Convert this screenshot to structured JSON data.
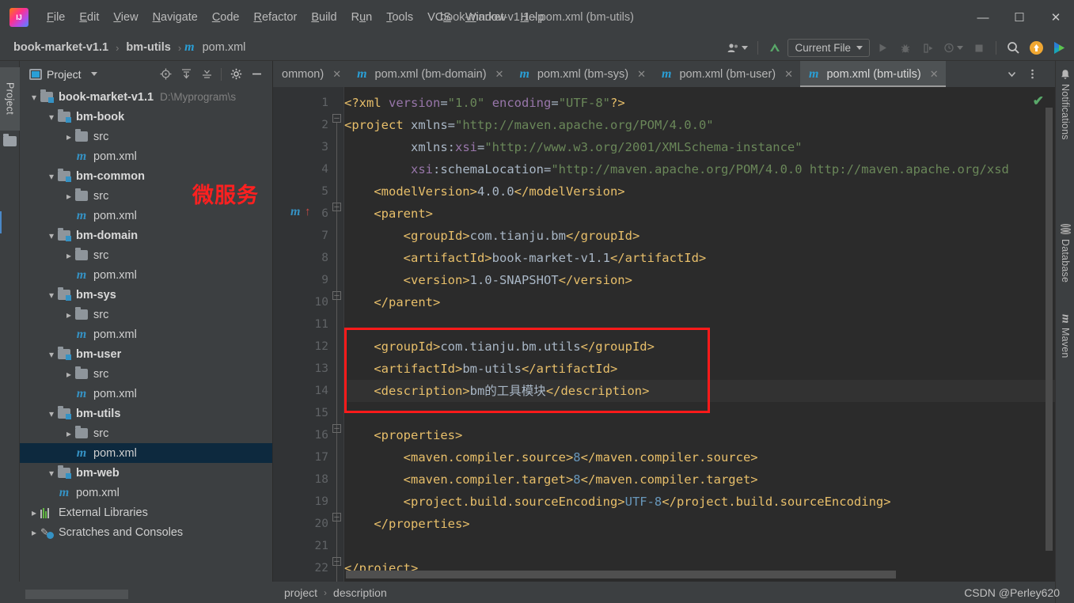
{
  "window": {
    "title": "book-market-v1.1 - pom.xml (bm-utils)",
    "minimize_label": "—",
    "maximize_label": "☐",
    "close_label": "✕",
    "logo_name": "intellij-idea-logo"
  },
  "menu": [
    {
      "label": "File",
      "mnemonic": "F"
    },
    {
      "label": "Edit",
      "mnemonic": "E"
    },
    {
      "label": "View",
      "mnemonic": "V"
    },
    {
      "label": "Navigate",
      "mnemonic": "N"
    },
    {
      "label": "Code",
      "mnemonic": "C"
    },
    {
      "label": "Refactor",
      "mnemonic": "R"
    },
    {
      "label": "Build",
      "mnemonic": "B"
    },
    {
      "label": "Run",
      "mnemonic": "u"
    },
    {
      "label": "Tools",
      "mnemonic": "T"
    },
    {
      "label": "VCS",
      "mnemonic": "S"
    },
    {
      "label": "Window",
      "mnemonic": "W"
    },
    {
      "label": "Help",
      "mnemonic": "H"
    }
  ],
  "breadcrumb": {
    "items": [
      "book-market-v1.1",
      "bm-utils",
      "pom.xml"
    ],
    "separator": "›",
    "file_icon": "m"
  },
  "toolbar": {
    "avatar_icon": "user-avatar-icon",
    "update_icon": "update-project-icon",
    "run_config": "Current File",
    "run_icon": "run-icon",
    "debug_icon": "debug-icon",
    "run_coverage_icon": "run-with-coverage-icon",
    "profile_icon": "profiler-icon",
    "stop_icon": "stop-icon",
    "search_icon": "search-everywhere-icon",
    "upload_icon": "upload-icon",
    "ide_assistant_icon": "ide-extension-icon"
  },
  "left_strip": {
    "project_label": "Project",
    "folder_icon": "folder-icon"
  },
  "project_panel": {
    "title": "Project",
    "actions": [
      "locate-icon",
      "expand-all-icon",
      "collapse-all-icon",
      "settings-gear-icon",
      "hide-icon"
    ],
    "annotation": "微服务",
    "tree": [
      {
        "label": "book-market-v1.1",
        "path": "D:\\Myprogram\\s",
        "icon": "module-folder-icon",
        "twisty": "open",
        "indent": 1,
        "bold": true
      },
      {
        "label": "bm-book",
        "icon": "module-folder-icon",
        "twisty": "open",
        "indent": 2,
        "bold": true
      },
      {
        "label": "src",
        "icon": "folder-icon",
        "twisty": "closed",
        "indent": 3,
        "bold": false
      },
      {
        "label": "pom.xml",
        "icon": "maven-file-icon",
        "twisty": "none",
        "indent": 3,
        "bold": false
      },
      {
        "label": "bm-common",
        "icon": "module-folder-icon",
        "twisty": "open",
        "indent": 2,
        "bold": true
      },
      {
        "label": "src",
        "icon": "folder-icon",
        "twisty": "closed",
        "indent": 3,
        "bold": false
      },
      {
        "label": "pom.xml",
        "icon": "maven-file-icon",
        "twisty": "none",
        "indent": 3,
        "bold": false
      },
      {
        "label": "bm-domain",
        "icon": "module-folder-icon",
        "twisty": "open",
        "indent": 2,
        "bold": true
      },
      {
        "label": "src",
        "icon": "folder-icon",
        "twisty": "closed",
        "indent": 3,
        "bold": false
      },
      {
        "label": "pom.xml",
        "icon": "maven-file-icon",
        "twisty": "none",
        "indent": 3,
        "bold": false
      },
      {
        "label": "bm-sys",
        "icon": "module-folder-icon",
        "twisty": "open",
        "indent": 2,
        "bold": true
      },
      {
        "label": "src",
        "icon": "folder-icon",
        "twisty": "closed",
        "indent": 3,
        "bold": false
      },
      {
        "label": "pom.xml",
        "icon": "maven-file-icon",
        "twisty": "none",
        "indent": 3,
        "bold": false
      },
      {
        "label": "bm-user",
        "icon": "module-folder-icon",
        "twisty": "open",
        "indent": 2,
        "bold": true
      },
      {
        "label": "src",
        "icon": "folder-icon",
        "twisty": "closed",
        "indent": 3,
        "bold": false
      },
      {
        "label": "pom.xml",
        "icon": "maven-file-icon",
        "twisty": "none",
        "indent": 3,
        "bold": false
      },
      {
        "label": "bm-utils",
        "icon": "module-folder-icon",
        "twisty": "open",
        "indent": 2,
        "bold": true
      },
      {
        "label": "src",
        "icon": "folder-icon",
        "twisty": "closed",
        "indent": 3,
        "bold": false
      },
      {
        "label": "pom.xml",
        "icon": "maven-file-icon",
        "twisty": "none",
        "indent": 3,
        "bold": false,
        "selected": true
      },
      {
        "label": "bm-web",
        "icon": "module-folder-icon",
        "twisty": "open",
        "indent": 2,
        "bold": true
      },
      {
        "label": "pom.xml",
        "icon": "maven-file-icon",
        "twisty": "none",
        "indent": 2,
        "bold": false
      },
      {
        "label": "External Libraries",
        "icon": "libraries-icon",
        "twisty": "closed",
        "indent": 1,
        "bold": false
      },
      {
        "label": "Scratches and Consoles",
        "icon": "scratches-icon",
        "twisty": "closed",
        "indent": 1,
        "bold": false
      }
    ]
  },
  "editor_tabs": {
    "tabs": [
      {
        "label": "ommon)",
        "icon": "",
        "active": false,
        "clipped": true
      },
      {
        "label": "pom.xml (bm-domain)",
        "icon": "m",
        "active": false
      },
      {
        "label": "pom.xml (bm-sys)",
        "icon": "m",
        "active": false
      },
      {
        "label": "pom.xml (bm-user)",
        "icon": "m",
        "active": false
      },
      {
        "label": "pom.xml (bm-utils)",
        "icon": "m",
        "active": true
      }
    ],
    "close_label": "✕",
    "dropdown_icon": "chevron-down-icon",
    "more_icon": "more-options-icon"
  },
  "editor": {
    "inspection_status_icon": "inspection-ok-check",
    "gutter_maven_icon": "m",
    "gutter_parent_arrow": "↑",
    "lines": [
      {
        "n": 1,
        "segments": [
          {
            "t": "<?xml ",
            "c": "pi"
          },
          {
            "t": "version",
            "c": "at"
          },
          {
            "t": "=",
            "c": "tx"
          },
          {
            "t": "\"1.0\"",
            "c": "st"
          },
          {
            "t": " ",
            "c": "tx"
          },
          {
            "t": "encoding",
            "c": "at"
          },
          {
            "t": "=",
            "c": "tx"
          },
          {
            "t": "\"UTF-8\"",
            "c": "st"
          },
          {
            "t": "?>",
            "c": "pi"
          }
        ]
      },
      {
        "n": 2,
        "segments": [
          {
            "t": "<project ",
            "c": "tg"
          },
          {
            "t": "xmlns",
            "c": "tx"
          },
          {
            "t": "=",
            "c": "tx"
          },
          {
            "t": "\"http://maven.apache.org/POM/4.0.0\"",
            "c": "st"
          }
        ]
      },
      {
        "n": 3,
        "segments": [
          {
            "t": "         xmlns:",
            "c": "tx"
          },
          {
            "t": "xsi",
            "c": "at"
          },
          {
            "t": "=",
            "c": "tx"
          },
          {
            "t": "\"http://www.w3.org/2001/XMLSchema-instance\"",
            "c": "st"
          }
        ]
      },
      {
        "n": 4,
        "segments": [
          {
            "t": "         ",
            "c": "tx"
          },
          {
            "t": "xsi",
            "c": "at"
          },
          {
            "t": ":schemaLocation=",
            "c": "tx"
          },
          {
            "t": "\"http://maven.apache.org/POM/4.0.0 http://maven.apache.org/xsd",
            "c": "st"
          }
        ]
      },
      {
        "n": 5,
        "segments": [
          {
            "t": "    <modelVersion>",
            "c": "tg"
          },
          {
            "t": "4.0.0",
            "c": "tx"
          },
          {
            "t": "</modelVersion>",
            "c": "tg"
          }
        ]
      },
      {
        "n": 6,
        "segments": [
          {
            "t": "    <parent>",
            "c": "tg"
          }
        ]
      },
      {
        "n": 7,
        "segments": [
          {
            "t": "        <groupId>",
            "c": "tg"
          },
          {
            "t": "com.tianju.bm",
            "c": "tx"
          },
          {
            "t": "</groupId>",
            "c": "tg"
          }
        ]
      },
      {
        "n": 8,
        "segments": [
          {
            "t": "        <artifactId>",
            "c": "tg"
          },
          {
            "t": "book-market-v1.1",
            "c": "tx"
          },
          {
            "t": "</artifactId>",
            "c": "tg"
          }
        ]
      },
      {
        "n": 9,
        "segments": [
          {
            "t": "        <version>",
            "c": "tg"
          },
          {
            "t": "1.0-SNAPSHOT",
            "c": "tx"
          },
          {
            "t": "</version>",
            "c": "tg"
          }
        ]
      },
      {
        "n": 10,
        "segments": [
          {
            "t": "    </parent>",
            "c": "tg"
          }
        ]
      },
      {
        "n": 11,
        "segments": []
      },
      {
        "n": 12,
        "segments": [
          {
            "t": "    <groupId>",
            "c": "tg"
          },
          {
            "t": "com.tianju.bm.utils",
            "c": "tx"
          },
          {
            "t": "</groupId>",
            "c": "tg"
          }
        ]
      },
      {
        "n": 13,
        "segments": [
          {
            "t": "    <artifactId>",
            "c": "tg"
          },
          {
            "t": "bm-utils",
            "c": "tx"
          },
          {
            "t": "</artifactId>",
            "c": "tg"
          }
        ]
      },
      {
        "n": 14,
        "segments": [
          {
            "t": "    <description>",
            "c": "tg"
          },
          {
            "t": "bm的工具模块",
            "c": "tx"
          },
          {
            "t": "</description>",
            "c": "tg"
          }
        ],
        "current": true
      },
      {
        "n": 15,
        "segments": []
      },
      {
        "n": 16,
        "segments": [
          {
            "t": "    <properties>",
            "c": "tg"
          }
        ]
      },
      {
        "n": 17,
        "segments": [
          {
            "t": "        <maven.compiler.source>",
            "c": "tg"
          },
          {
            "t": "8",
            "c": "nm"
          },
          {
            "t": "</maven.compiler.source>",
            "c": "tg"
          }
        ]
      },
      {
        "n": 18,
        "segments": [
          {
            "t": "        <maven.compiler.target>",
            "c": "tg"
          },
          {
            "t": "8",
            "c": "nm"
          },
          {
            "t": "</maven.compiler.target>",
            "c": "tg"
          }
        ]
      },
      {
        "n": 19,
        "segments": [
          {
            "t": "        <project.build.sourceEncoding>",
            "c": "tg"
          },
          {
            "t": "UTF-8",
            "c": "nm"
          },
          {
            "t": "</project.build.sourceEncoding>",
            "c": "tg"
          }
        ]
      },
      {
        "n": 20,
        "segments": [
          {
            "t": "    </properties>",
            "c": "tg"
          }
        ]
      },
      {
        "n": 21,
        "segments": []
      },
      {
        "n": 22,
        "segments": [
          {
            "t": "</project>",
            "c": "tg"
          }
        ]
      }
    ]
  },
  "right_strip": {
    "items": [
      {
        "label": "Notifications",
        "icon": "bell-icon"
      },
      {
        "label": "Database",
        "icon": "database-icon"
      },
      {
        "label": "Maven",
        "icon": "maven-icon"
      }
    ]
  },
  "status_bar": {
    "breadcrumb": [
      "project",
      "description"
    ],
    "separator": "›",
    "watermark": "CSDN @Perley620"
  },
  "colors": {
    "accent_blue": "#3592c4",
    "annotation_red": "#ff1a1a",
    "selection_navy": "#0d293e",
    "tag_orange": "#e8bf6a",
    "string_green": "#6a8759",
    "attr_purple": "#9876aa",
    "number_blue": "#6897bb",
    "ok_green": "#59a869"
  }
}
